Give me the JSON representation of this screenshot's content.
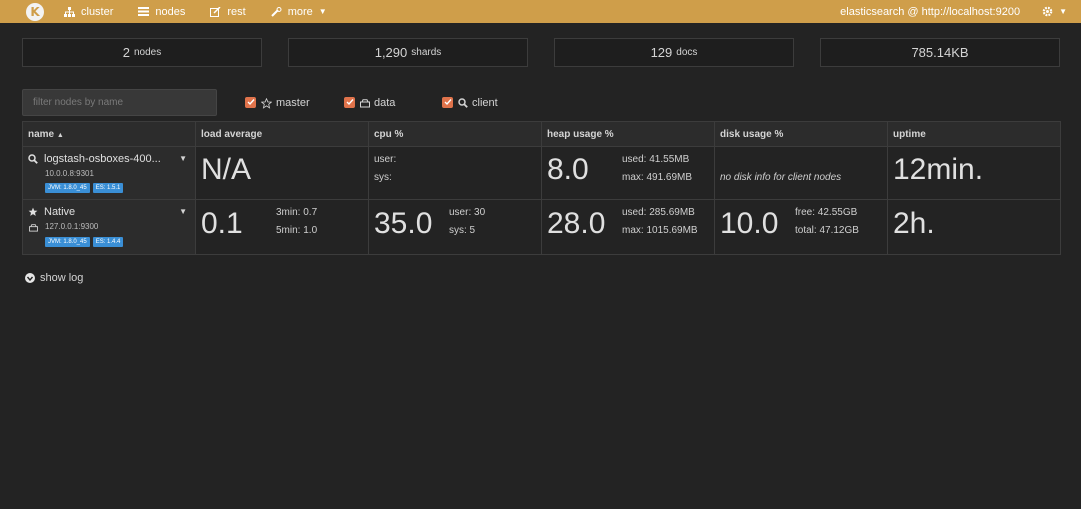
{
  "navbar": {
    "items": [
      {
        "label": "cluster",
        "icon": "sitemap-icon"
      },
      {
        "label": "nodes",
        "icon": "list-icon"
      },
      {
        "label": "rest",
        "icon": "edit-icon"
      },
      {
        "label": "more",
        "icon": "wrench-icon"
      }
    ],
    "cluster_url": "elasticsearch @ http://localhost:9200"
  },
  "stats": [
    {
      "value": "2",
      "label": "nodes"
    },
    {
      "value": "1,290",
      "label": "shards"
    },
    {
      "value": "129",
      "label": "docs"
    },
    {
      "value": "785.14KB",
      "label": ""
    }
  ],
  "filter": {
    "placeholder": "filter nodes by name",
    "value": "",
    "checkboxes": [
      {
        "label": "master",
        "checked": true,
        "icon": "star-icon"
      },
      {
        "label": "data",
        "checked": true,
        "icon": "hdd-icon"
      },
      {
        "label": "client",
        "checked": true,
        "icon": "search-icon"
      }
    ]
  },
  "table": {
    "headers": [
      "name",
      "load average",
      "cpu %",
      "heap usage %",
      "disk usage %",
      "uptime"
    ],
    "sort_indicator": "▲",
    "rows": [
      {
        "name": "logstash-osboxes-400...",
        "address": "10.0.0.8:9301",
        "badges": [
          "JVM: 1.8.0_45",
          "ES: 1.5.1"
        ],
        "load": "N/A",
        "load_3min": "",
        "load_5min": "",
        "cpu": "",
        "cpu_user": "user:",
        "cpu_sys": "sys:",
        "heap": "8.0",
        "heap_used": "used: 41.55MB",
        "heap_max": "max: 491.69MB",
        "disk": "",
        "disk_note": "no disk info for client nodes",
        "uptime": "12min."
      },
      {
        "name": "Native",
        "address": "127.0.0.1:9300",
        "badges": [
          "JVM: 1.8.0_45",
          "ES: 1.4.4"
        ],
        "load": "0.1",
        "load_3min": "3min: 0.7",
        "load_5min": "5min: 1.0",
        "cpu": "35.0",
        "cpu_user": "user: 30",
        "cpu_sys": "sys: 5",
        "heap": "28.0",
        "heap_used": "used: 285.69MB",
        "heap_max": "max: 1015.69MB",
        "disk": "10.0",
        "disk_free": "free: 42.55GB",
        "disk_total": "total: 47.12GB",
        "uptime": "2h."
      }
    ]
  },
  "show_log": "show log",
  "colors": {
    "navbar": "#cf9e4a",
    "background": "#232323",
    "checkbox": "#e0734b",
    "badge": "#3a8fd6"
  }
}
